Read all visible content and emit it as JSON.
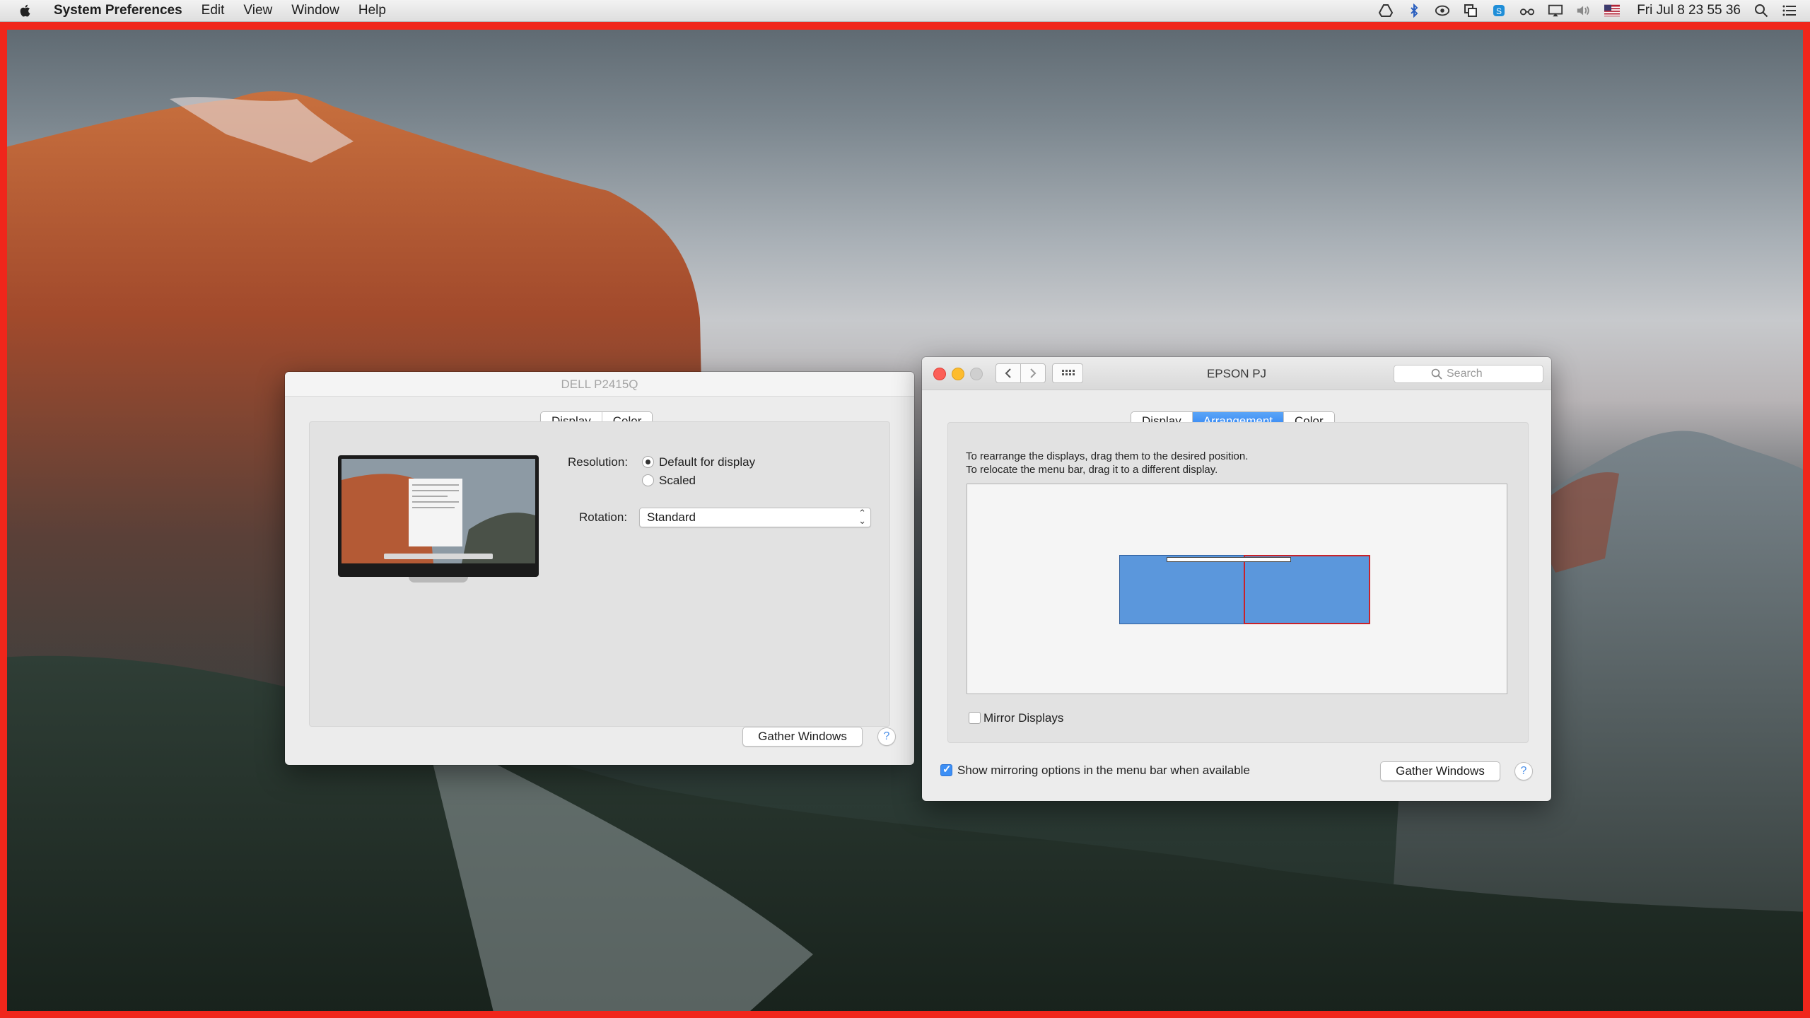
{
  "menubar": {
    "app_name": "System Preferences",
    "menus": [
      "Edit",
      "View",
      "Window",
      "Help"
    ],
    "clock": "Fri Jul 8  23 55 36"
  },
  "dell_window": {
    "title": "DELL P2415Q",
    "tabs": [
      {
        "label": "Display",
        "selected": false
      },
      {
        "label": "Color",
        "selected": false
      }
    ],
    "resolution_label": "Resolution:",
    "resolution_options": [
      {
        "label": "Default for display",
        "selected": true
      },
      {
        "label": "Scaled",
        "selected": false
      }
    ],
    "rotation_label": "Rotation:",
    "rotation_value": "Standard",
    "gather_windows": "Gather Windows",
    "help": "?"
  },
  "epson_window": {
    "title": "EPSON PJ",
    "search_placeholder": "Search",
    "tabs": [
      {
        "label": "Display",
        "selected": false
      },
      {
        "label": "Arrangement",
        "selected": true
      },
      {
        "label": "Color",
        "selected": false
      }
    ],
    "instructions": [
      "To rearrange the displays, drag them to the desired position.",
      "To relocate the menu bar, drag it to a different display."
    ],
    "mirror_displays_label": "Mirror Displays",
    "mirror_displays_checked": false,
    "show_mirroring_label": "Show mirroring options in the menu bar when available",
    "show_mirroring_checked": true,
    "gather_windows": "Gather Windows",
    "help": "?"
  },
  "colors": {
    "accent": "#2a7ff2",
    "display_blue": "#5b97dc",
    "selected_display_border": "#c8222a",
    "desktop_frame": "#f0261b"
  }
}
